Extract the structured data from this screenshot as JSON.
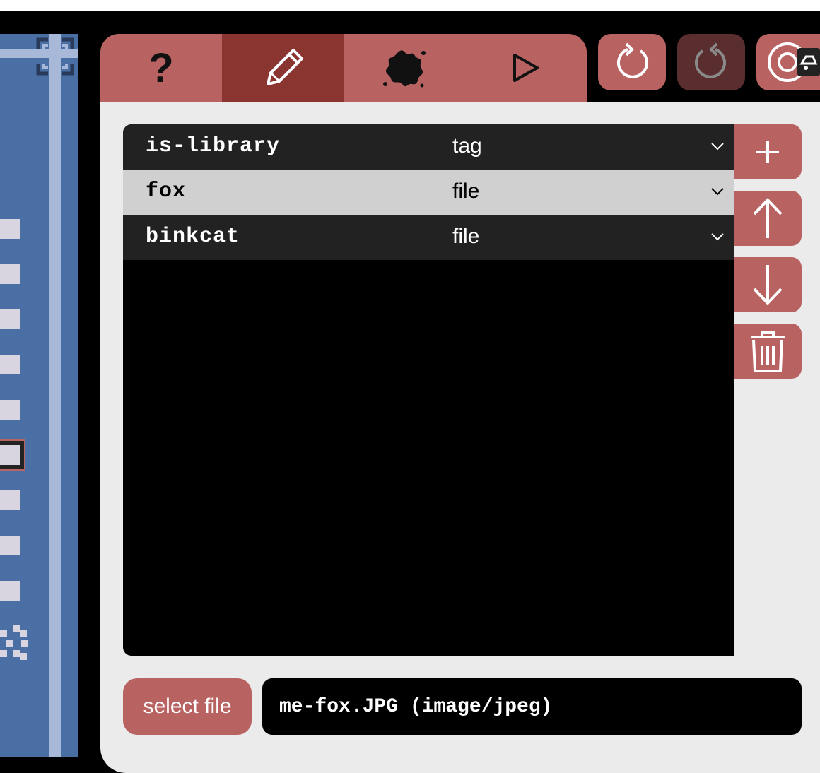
{
  "toolbar": {
    "tabs": [
      {
        "icon": "help-icon",
        "label": "?"
      },
      {
        "icon": "pencil-icon",
        "active": true
      },
      {
        "icon": "splat-icon"
      },
      {
        "icon": "play-icon"
      }
    ],
    "buttons": [
      {
        "icon": "undo-icon"
      },
      {
        "icon": "redo-icon",
        "disabled": true
      },
      {
        "icon": "settings-icon"
      }
    ]
  },
  "assets": {
    "rows": [
      {
        "name": "is-library",
        "type": "tag",
        "selected": false
      },
      {
        "name": "fox",
        "type": "file",
        "selected": true
      },
      {
        "name": "binkcat",
        "type": "file",
        "selected": false
      }
    ],
    "actions": [
      {
        "icon": "plus-icon"
      },
      {
        "icon": "arrow-up-icon"
      },
      {
        "icon": "arrow-down-icon"
      },
      {
        "icon": "trash-icon"
      }
    ]
  },
  "file": {
    "button_label": "select file",
    "value": "me-fox.JPG (image/jpeg)"
  },
  "colors": {
    "accent": "#b86262",
    "accent_active": "#8b3530",
    "panel": "#ebebeb",
    "sidebar": "#4a6fa5"
  }
}
